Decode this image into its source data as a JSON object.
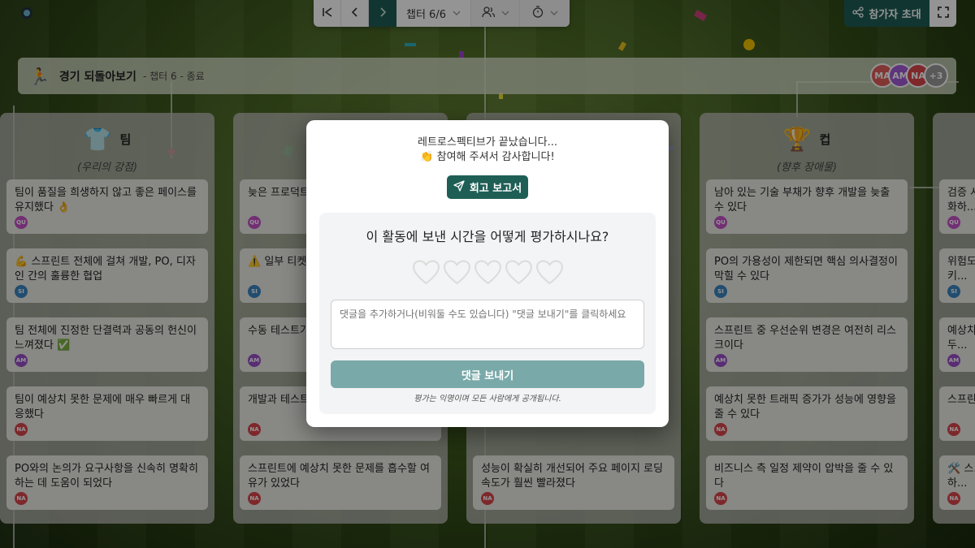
{
  "toolbar": {
    "chapter_label": "챕터 6/6"
  },
  "invite": {
    "label": "참가자 초대"
  },
  "header": {
    "title": "경기 되돌아보기",
    "subtitle": "- 챕터 6 - 종료",
    "avatars": [
      {
        "initials": "MA",
        "color": "#e0605a"
      },
      {
        "initials": "AM",
        "color": "#a35ad6"
      },
      {
        "initials": "NA",
        "color": "#d9454a"
      },
      {
        "initials": "+3",
        "color": "#9a9a9a"
      }
    ]
  },
  "columns": [
    {
      "title": "팀",
      "emoji": "👕",
      "subtitle": "(우리의 강점)",
      "cards": [
        {
          "text": "팀이 품질을 희생하지 않고 좋은 페이스를 유지했다 👌",
          "author": "QU",
          "color": "#c452c6"
        },
        {
          "text": "💪 스프린트 전체에 걸쳐 개발, PO, 디자인 간의 훌륭한 협업",
          "author": "SI",
          "color": "#3a85c0"
        },
        {
          "text": "팀 전체에 진정한 단결력과 공동의 헌신이 느껴졌다 ✅",
          "author": "AM",
          "color": "#9a4fc8"
        },
        {
          "text": "팀이 예상치 못한 문제에 매우 빠르게 대응했다",
          "author": "NA",
          "color": "#d9454a"
        },
        {
          "text": "PO와의 논의가 요구사항을 신속히 명확히 하는 데 도움이 되었다",
          "author": "NA",
          "color": "#d9454a"
        }
      ]
    },
    {
      "cards": [
        {
          "text": "늦은 프로덕트... 낭비했다",
          "author": "QU",
          "color": "#c452c6"
        },
        {
          "text": "⚠️ 일부 티켓이... 확하지 않았다",
          "author": "SI",
          "color": "#3a85c0"
        },
        {
          "text": "수동 테스트가...",
          "author": "AM",
          "color": "#9a4fc8"
        },
        {
          "text": "개발과 테스트... 작할 수 있었다",
          "author": "NA",
          "color": "#d9454a"
        },
        {
          "text": "스프린트에 예상치 못한 문제를 흡수할 여유가 있었다",
          "author": "NA",
          "color": "#d9454a"
        }
      ]
    },
    {
      "cards": [
        {
          "text": "성능이 확실히 개선되어 주요 페이지 로딩 속도가 훨씬 빨라졌다",
          "author": "NA",
          "color": "#d9454a"
        }
      ]
    },
    {
      "title": "컵",
      "emoji": "🏆",
      "subtitle": "(향후 장애물)",
      "cards": [
        {
          "text": "남아 있는 기술 부채가 향후 개발을 늦출 수 있다",
          "author": "QU",
          "color": "#c452c6"
        },
        {
          "text": "PO의 가용성이 제한되면 핵심 의사결정이 막힐 수 있다",
          "author": "SI",
          "color": "#3a85c0"
        },
        {
          "text": "스프린트 중 우선순위 변경은 여전히 리스크이다",
          "author": "AM",
          "color": "#9a4fc8"
        },
        {
          "text": "예상치 못한 트래픽 증가가 성능에 영향을 줄 수 있다",
          "author": "NA",
          "color": "#d9454a"
        },
        {
          "text": "비즈니스 측 일정 제약이 압박을 줄 수 있다",
          "author": "NA",
          "color": "#d9454a"
        }
      ]
    },
    {
      "cards": [
        {
          "text": "검증 시... 강화하...",
          "author": "QU",
          "color": "#c452c6"
        },
        {
          "text": "위험도... 여시키...",
          "author": "SI",
          "color": "#3a85c0"
        },
        {
          "text": "예상치... 유를 두...",
          "author": "AM",
          "color": "#9a4fc8"
        },
        {
          "text": "스프린...",
          "author": "NA",
          "color": "#d9454a"
        },
        {
          "text": "🛠️ 스... 확히 하...",
          "author": "NA",
          "color": "#d9454a"
        }
      ]
    }
  ],
  "modal": {
    "line1": "레트로스펙티브가 끝났습니다...",
    "line2": "👏 참여해 주셔서 감사합니다!",
    "report_button": "회고 보고서",
    "question": "이 활동에 보낸 시간을 어떻게 평가하시나요?",
    "rating_max": 5,
    "rating_value": 0,
    "comment_placeholder": "댓글을 추가하거나(비워둘 수도 있습니다) \"댓글 보내기\"를 클릭하세요",
    "send_button": "댓글 보내기",
    "anonymous_note": "평가는 익명이며 모든 사람에게 공개됩니다."
  }
}
